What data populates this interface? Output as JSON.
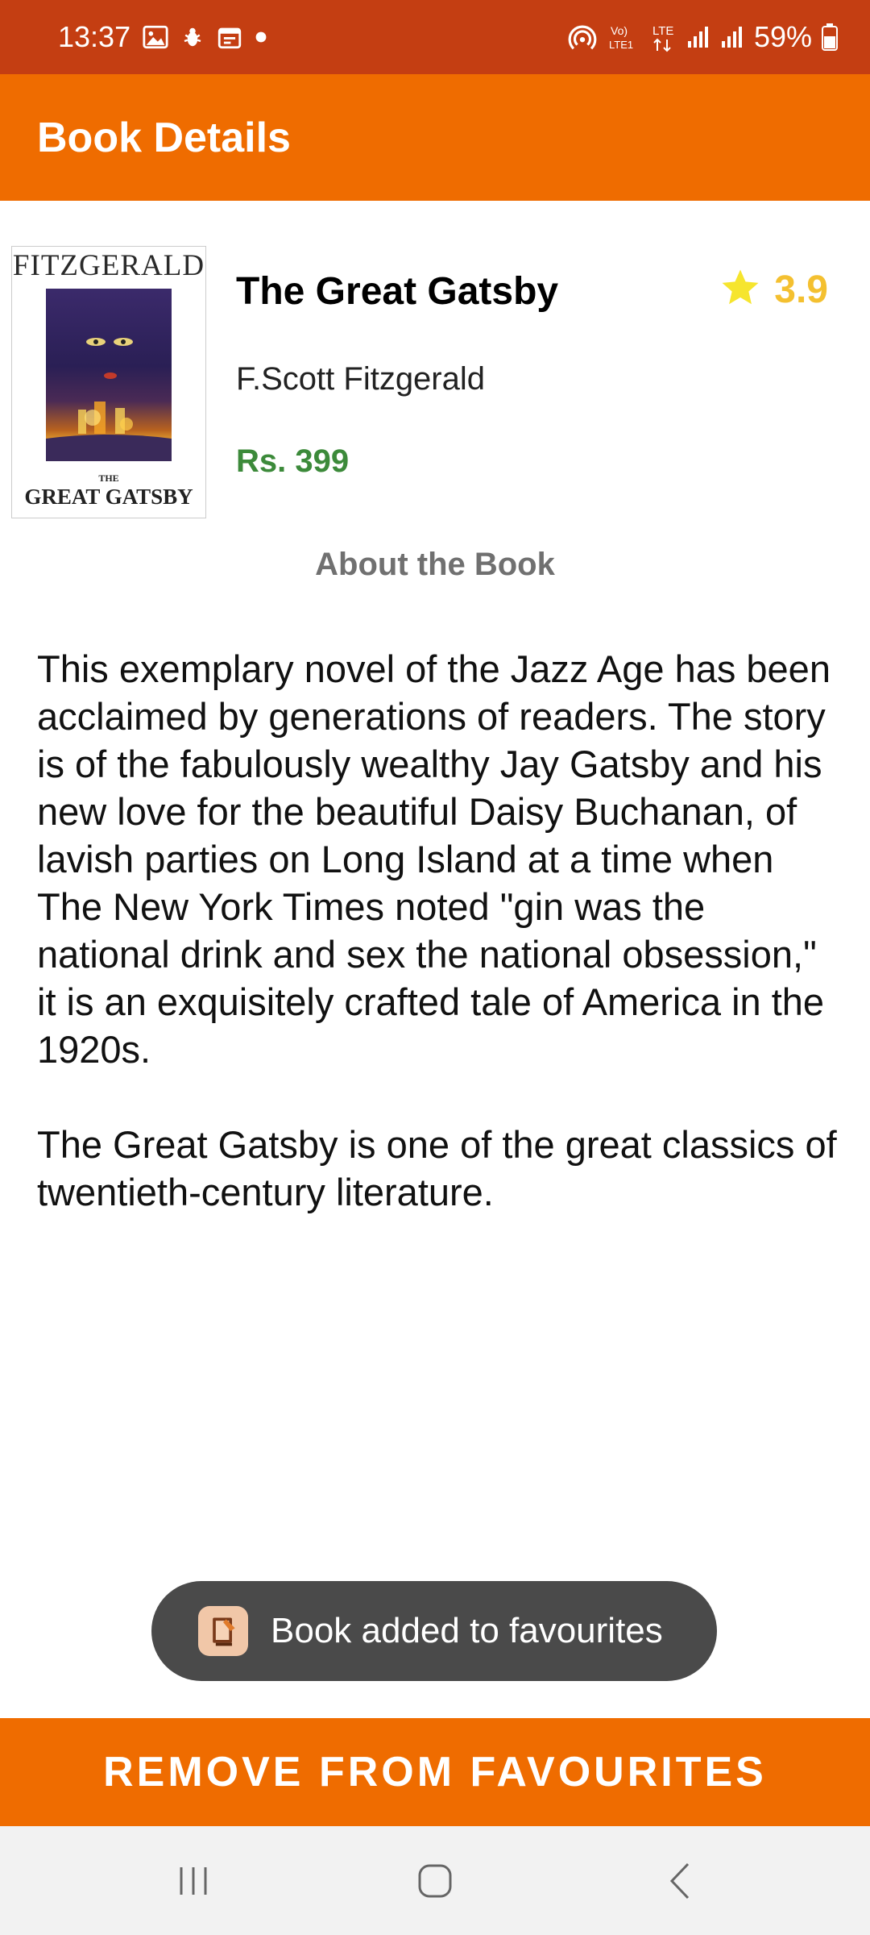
{
  "status_bar": {
    "time": "13:37",
    "battery": "59%",
    "icons": [
      "image-icon",
      "bug-icon",
      "calendar-icon",
      "dot-icon",
      "hotspot-icon",
      "volte-icon",
      "lte-icon",
      "signal-icon",
      "signal-icon",
      "battery-icon"
    ]
  },
  "app_bar": {
    "title": "Book Details"
  },
  "book": {
    "cover": {
      "top_text": "FITZGERALD",
      "small_text": "THE",
      "bottom_text": "GREAT GATSBY"
    },
    "title": "The Great Gatsby",
    "rating": "3.9",
    "author": "F.Scott Fitzgerald",
    "price": "Rs. 399"
  },
  "about": {
    "heading": "About the Book",
    "description": "This exemplary novel of the Jazz Age has been acclaimed by generations of readers. The story is of the fabulously wealthy Jay Gatsby and his new love for the beautiful Daisy Buchanan, of lavish parties on Long Island at a time when The New York Times noted \"gin was the national drink and sex the national obsession,\" it is an exquisitely crafted tale of America in the 1920s.\n\nThe Great Gatsby is one of the great classics of twentieth-century literature."
  },
  "toast": {
    "message": "Book added to favourites"
  },
  "actions": {
    "remove_label": "REMOVE FROM FAVOURITES"
  },
  "colors": {
    "status_bar": "#c43e12",
    "app_bar": "#ef6c00",
    "star": "#f4c030",
    "price": "#3c8a3a",
    "toast": "#4a4a4a"
  }
}
